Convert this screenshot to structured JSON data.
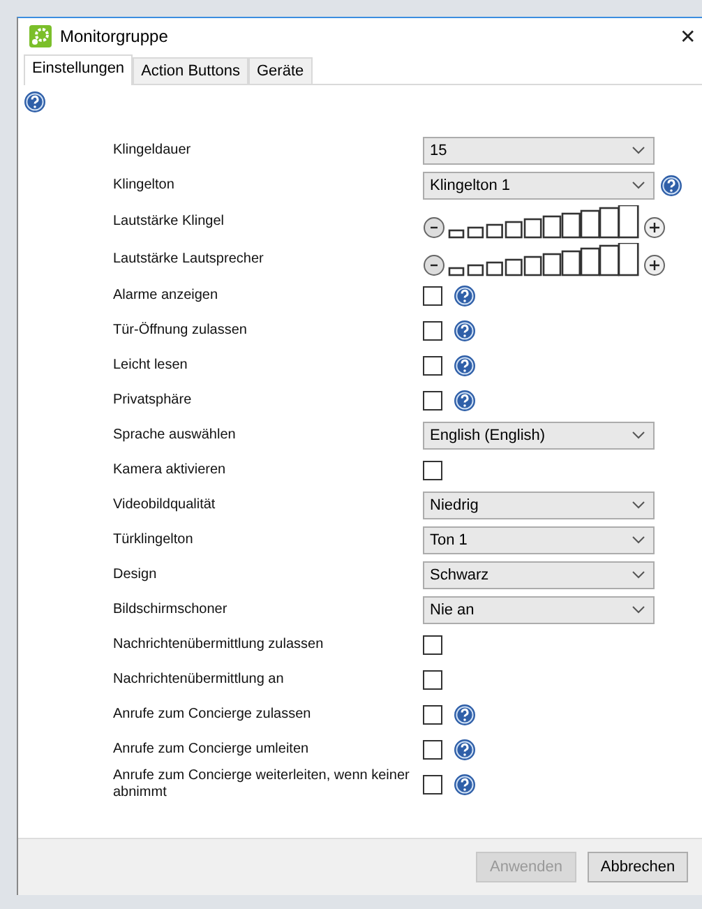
{
  "window": {
    "title": "Monitorgruppe",
    "close": "✕"
  },
  "tabs": [
    {
      "label": "Einstellungen",
      "selected": true
    },
    {
      "label": "Action Buttons",
      "selected": false
    },
    {
      "label": "Geräte",
      "selected": false
    }
  ],
  "settings": [
    {
      "kind": "select",
      "label": "Klingeldauer",
      "value": "15",
      "help": false
    },
    {
      "kind": "select",
      "label": "Klingelton",
      "value": "Klingelton 1",
      "help": true
    },
    {
      "kind": "volume",
      "label": "Lautstärke Klingel"
    },
    {
      "kind": "volume",
      "label": "Lautstärke Lautsprecher"
    },
    {
      "kind": "checkbox",
      "label": "Alarme anzeigen",
      "checked": false,
      "help": true
    },
    {
      "kind": "checkbox",
      "label": "Tür-Öffnung zulassen",
      "checked": false,
      "help": true
    },
    {
      "kind": "checkbox",
      "label": "Leicht lesen",
      "checked": false,
      "help": true
    },
    {
      "kind": "checkbox",
      "label": "Privatsphäre",
      "checked": false,
      "help": true
    },
    {
      "kind": "select",
      "label": "Sprache auswählen",
      "value": "English (English)",
      "help": false
    },
    {
      "kind": "checkbox",
      "label": "Kamera aktivieren",
      "checked": false,
      "help": false
    },
    {
      "kind": "select",
      "label": "Videobildqualität",
      "value": "Niedrig",
      "help": false
    },
    {
      "kind": "select",
      "label": "Türklingelton",
      "value": "Ton 1",
      "help": false
    },
    {
      "kind": "select",
      "label": "Design",
      "value": "Schwarz",
      "help": false
    },
    {
      "kind": "select",
      "label": "Bildschirmschoner",
      "value": "Nie an",
      "help": false
    },
    {
      "kind": "checkbox",
      "label": "Nachrichtenübermittlung zulassen",
      "checked": false,
      "help": false
    },
    {
      "kind": "checkbox",
      "label": "Nachrichtenübermittlung an",
      "checked": false,
      "help": false
    },
    {
      "kind": "checkbox",
      "label": "Anrufe zum Concierge zulassen",
      "checked": false,
      "help": true
    },
    {
      "kind": "checkbox",
      "label": "Anrufe zum Concierge umleiten",
      "checked": false,
      "help": true
    },
    {
      "kind": "checkbox",
      "label": "Anrufe zum Concierge weiterleiten, wenn keiner abnimmt",
      "checked": false,
      "help": true
    }
  ],
  "buttons": [
    {
      "label": "Anwenden",
      "disabled": true
    },
    {
      "label": "Abbrechen",
      "disabled": false
    }
  ]
}
